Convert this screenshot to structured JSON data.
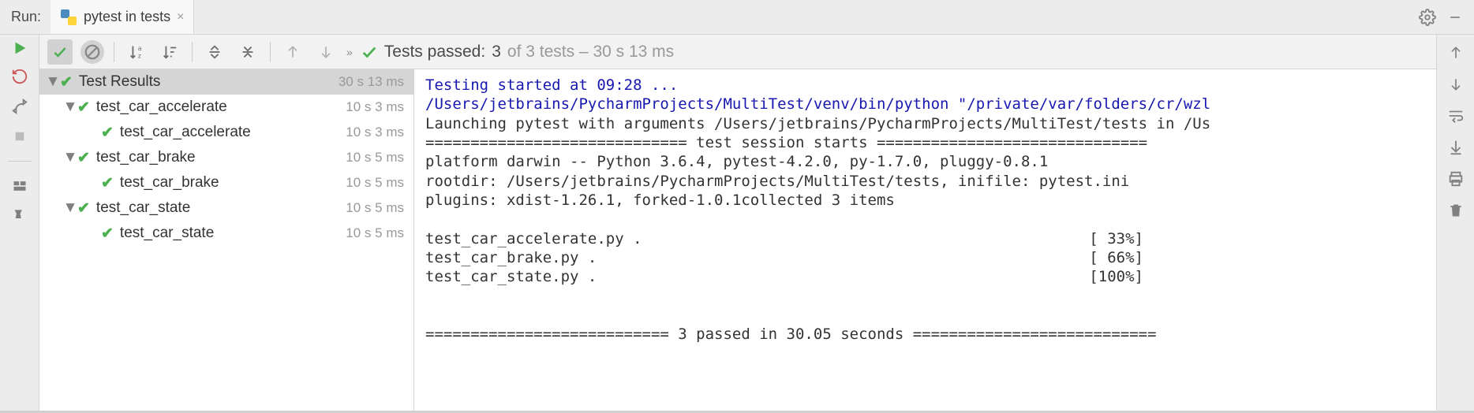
{
  "header": {
    "run_label": "Run:",
    "tab_label": "pytest in tests"
  },
  "status": {
    "prefix": "Tests passed:",
    "passed": "3",
    "suffix": "of 3 tests – 30 s 13 ms"
  },
  "tree": {
    "root_label": "Test Results",
    "root_time": "30 s 13 ms",
    "items": [
      {
        "label": "test_car_accelerate",
        "time": "10 s 3 ms",
        "child_label": "test_car_accelerate",
        "child_time": "10 s 3 ms"
      },
      {
        "label": "test_car_brake",
        "time": "10 s 5 ms",
        "child_label": "test_car_brake",
        "child_time": "10 s 5 ms"
      },
      {
        "label": "test_car_state",
        "time": "10 s 5 ms",
        "child_label": "test_car_state",
        "child_time": "10 s 5 ms"
      }
    ]
  },
  "console": {
    "line1": "Testing started at 09:28 ...",
    "line2": "/Users/jetbrains/PycharmProjects/MultiTest/venv/bin/python \"/private/var/folders/cr/wzl",
    "line3": "Launching pytest with arguments /Users/jetbrains/PycharmProjects/MultiTest/tests in /Us",
    "line4": "============================= test session starts ==============================",
    "line5": "platform darwin -- Python 3.6.4, pytest-4.2.0, py-1.7.0, pluggy-0.8.1",
    "line6": "rootdir: /Users/jetbrains/PycharmProjects/MultiTest/tests, inifile: pytest.ini",
    "line7": "plugins: xdist-1.26.1, forked-1.0.1collected 3 items",
    "line8": "",
    "line9a": "test_car_accelerate.py .",
    "line9b": "[ 33%]",
    "line10a": "test_car_brake.py .",
    "line10b": "[ 66%]",
    "line11a": "test_car_state.py .",
    "line11b": "[100%]",
    "line12": "",
    "line13": "=========================== 3 passed in 30.05 seconds ==========================="
  }
}
